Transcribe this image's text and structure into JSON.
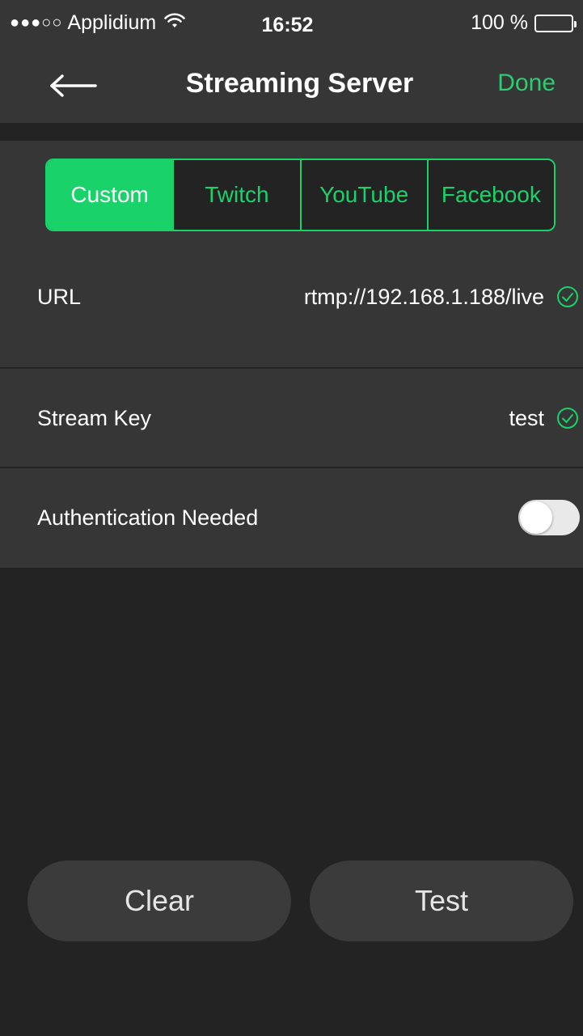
{
  "status_bar": {
    "signal": "●●●○○",
    "carrier": "Applidium",
    "time": "16:52",
    "battery": "100 %"
  },
  "nav": {
    "title": "Streaming Server",
    "done_label": "Done"
  },
  "segments": [
    {
      "label": "Custom",
      "selected": true
    },
    {
      "label": "Twitch",
      "selected": false
    },
    {
      "label": "YouTube",
      "selected": false
    },
    {
      "label": "Facebook",
      "selected": false
    }
  ],
  "rows": {
    "url": {
      "label": "URL",
      "value": "rtmp://192.168.1.188/live"
    },
    "stream_key": {
      "label": "Stream Key",
      "value": "test"
    },
    "auth": {
      "label": "Authentication Needed",
      "enabled": false
    }
  },
  "buttons": {
    "clear": "Clear",
    "test": "Test"
  },
  "colors": {
    "accent": "#19d26a",
    "background": "#232323",
    "panel": "#363636"
  }
}
